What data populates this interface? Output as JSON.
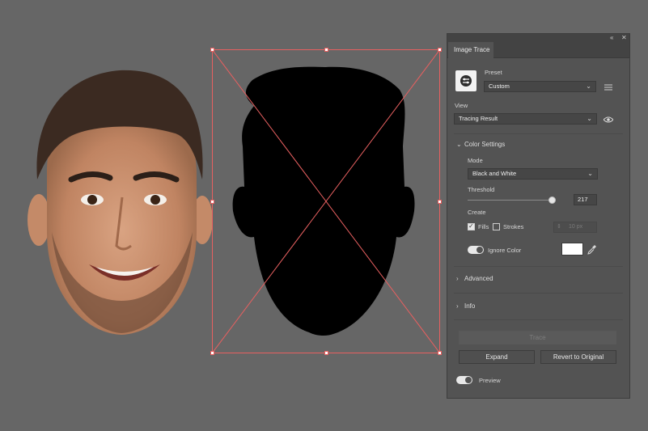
{
  "panel": {
    "title": "Image Trace",
    "preset_label": "Preset",
    "preset_value": "Custom",
    "view_label": "View",
    "view_value": "Tracing Result",
    "color_settings": "Color Settings",
    "mode_label": "Mode",
    "mode_value": "Black and White",
    "threshold_label": "Threshold",
    "threshold_value": "217",
    "threshold_level": 0.85,
    "create_label": "Create",
    "fills_label": "Fills",
    "fills_checked": true,
    "strokes_label": "Strokes",
    "strokes_checked": false,
    "stroke_width": "10 px",
    "ignore_color_label": "Ignore Color",
    "ignore_color_on": true,
    "ignore_color_swatch": "#ffffff",
    "advanced": "Advanced",
    "info": "Info",
    "trace_button": "Trace",
    "expand_button": "Expand",
    "revert_button": "Revert to Original",
    "preview_label": "Preview",
    "preview_on": true
  },
  "icons": {
    "collapse": "collapse-icon",
    "close": "close-icon",
    "preset": "trace-preset-icon",
    "list": "preset-list-icon",
    "eye": "eye-icon",
    "eyedropper": "eyedropper-icon"
  },
  "colors": {
    "canvas_bg": "#666666",
    "panel_bg": "#535353",
    "selection": "#e86060"
  }
}
